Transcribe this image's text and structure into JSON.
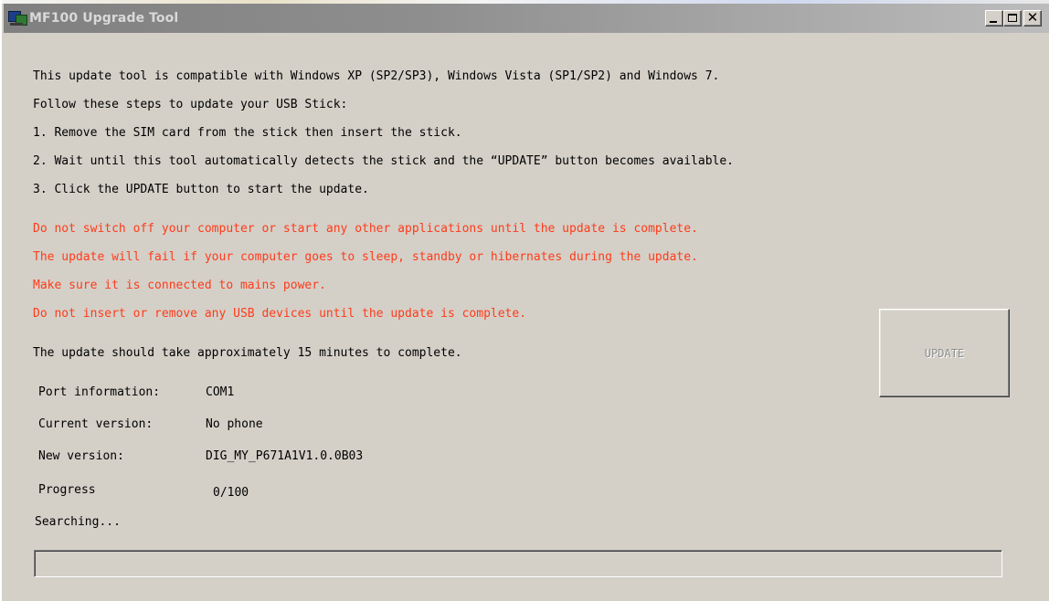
{
  "window": {
    "title": "MF100 Upgrade Tool"
  },
  "instructions": {
    "lines": [
      "This update tool is compatible with Windows XP (SP2/SP3), Windows Vista (SP1/SP2) and Windows 7.",
      "Follow these steps to update your USB Stick:",
      "1. Remove the SIM card from the stick then insert the stick.",
      "2. Wait until this tool automatically detects the stick and the “UPDATE” button becomes available.",
      "3. Click the UPDATE button to start the update."
    ],
    "warnings": [
      "Do not switch off your computer or start any other applications until the update is complete.",
      "The update will fail if your computer goes to sleep, standby or hibernates during the update.",
      "Make sure it is connected to mains power.",
      "Do not insert or remove any USB devices until the update is complete."
    ],
    "duration": "The update should take approximately 15 minutes to complete."
  },
  "info": {
    "port_label": "Port information:",
    "port_value": "COM1",
    "current_label": "Current version:",
    "current_value": "No phone",
    "new_label": "New version:",
    "new_value": "DIG_MY_P671A1V1.0.0B03",
    "progress_label": "Progress",
    "progress_value": "0/100"
  },
  "status": "Searching...",
  "progress": {
    "value": 0,
    "max": 100
  },
  "buttons": {
    "update_label": "UPDATE",
    "update_enabled": false
  },
  "colors": {
    "warning_text": "#ff3b1a",
    "window_face": "#d4d0c8",
    "titlebar_inactive": "#808080"
  },
  "icons": {
    "app": "computer-monitor-icon",
    "minimize": "minimize-icon",
    "maximize": "maximize-icon",
    "close": "close-icon"
  }
}
